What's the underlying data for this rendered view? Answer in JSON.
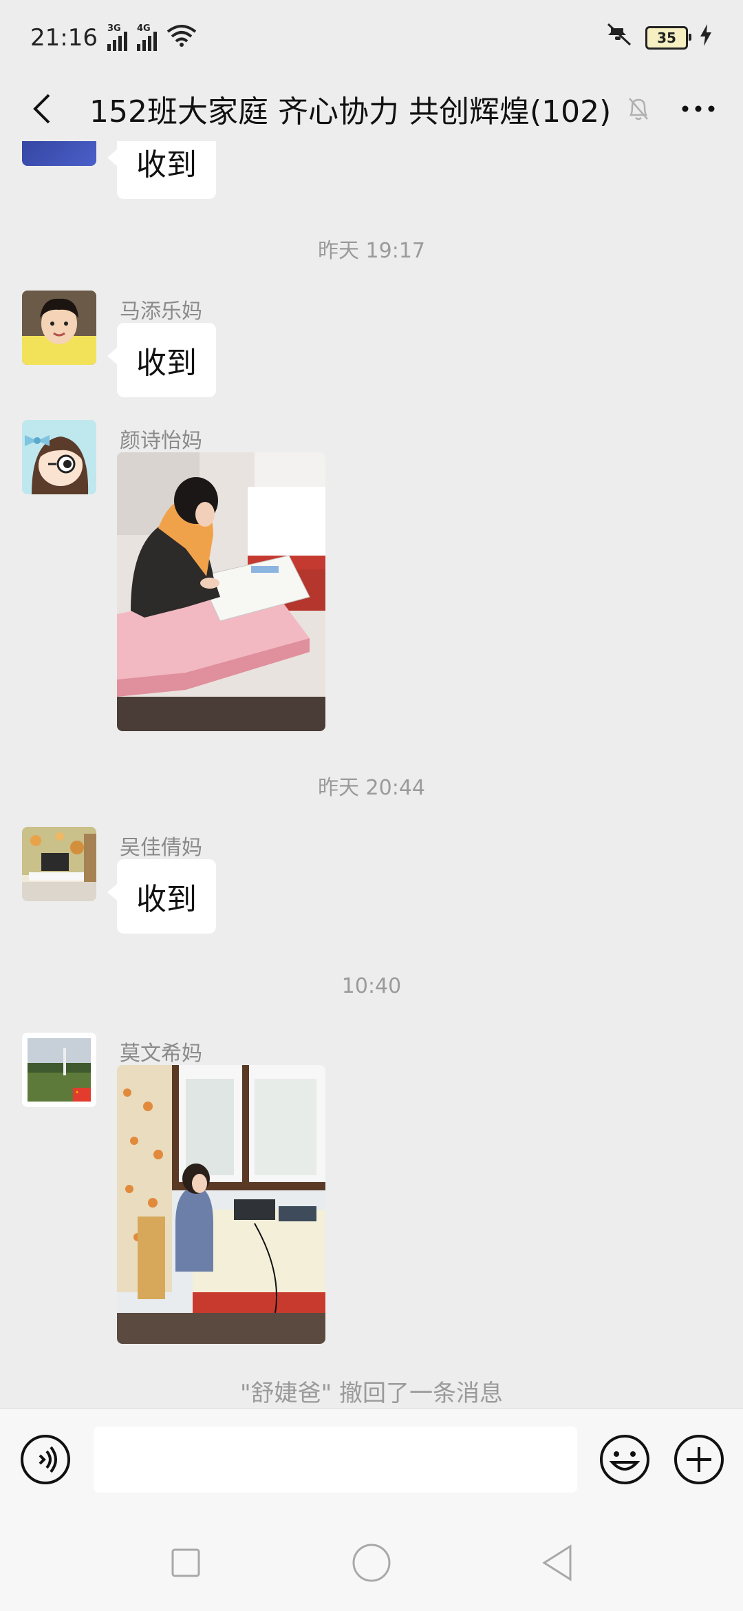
{
  "status_bar": {
    "time": "21:16",
    "network1": "3G",
    "network2": "4G",
    "battery": "35"
  },
  "header": {
    "title": "152班大家庭 齐心协力 共创辉煌(102)"
  },
  "messages": {
    "partial_bubble": "收到",
    "ts1": "昨天 19:17",
    "m1_sender": "马添乐妈",
    "m1_text": "收到",
    "m2_sender": "颜诗怡妈",
    "ts2": "昨天 20:44",
    "m3_sender": "吴佳倩妈",
    "m3_text": "收到",
    "ts3": "10:40",
    "m4_sender": "莫文希妈",
    "recall_notice": "\"舒婕爸\" 撤回了一条消息"
  },
  "input": {
    "placeholder": ""
  },
  "icons": {
    "back": "back-arrow-icon",
    "mute": "bell-muted-icon",
    "more": "more-dots-icon",
    "voice": "voice-icon",
    "emoji": "emoji-icon",
    "plus": "plus-icon"
  },
  "colors": {
    "background": "#EDEDED",
    "bubble": "#FFFFFF",
    "timestamp": "#9A9A9A"
  }
}
